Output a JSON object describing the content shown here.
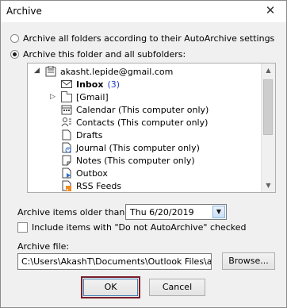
{
  "window": {
    "title": "Archive",
    "close_glyph": "✕"
  },
  "options": {
    "archive_all": {
      "label": "Archive all folders according to their AutoArchive settings",
      "selected": false
    },
    "archive_this": {
      "label": "Archive this folder and all subfolders:",
      "selected": true
    }
  },
  "tree": {
    "root": {
      "label": "akasht.lepide@gmail.com",
      "toggle": "◢",
      "icon": "mailbox-icon"
    },
    "items": [
      {
        "label": "Inbox",
        "count": "(3)",
        "icon": "envelope-icon",
        "bold": true
      },
      {
        "label": "[Gmail]",
        "icon": "folder-icon",
        "toggle": "▷"
      },
      {
        "label": "Calendar (This computer only)",
        "icon": "calendar-icon"
      },
      {
        "label": "Contacts (This computer only)",
        "icon": "contacts-icon"
      },
      {
        "label": "Drafts",
        "icon": "drafts-icon"
      },
      {
        "label": "Journal (This computer only)",
        "icon": "journal-icon"
      },
      {
        "label": "Notes (This computer only)",
        "icon": "notes-icon"
      },
      {
        "label": "Outbox",
        "icon": "outbox-icon"
      },
      {
        "label": "RSS Feeds",
        "icon": "rss-icon"
      }
    ]
  },
  "older_than": {
    "label": "Archive items older than:",
    "value": "Thu 6/20/2019"
  },
  "no_autoarchive": {
    "label": "Include items with \"Do not AutoArchive\" checked",
    "checked": false
  },
  "archive_file": {
    "label": "Archive file:",
    "value": "C:\\Users\\AkashT\\Documents\\Outlook Files\\arc"
  },
  "buttons": {
    "browse": "Browse...",
    "ok": "OK",
    "cancel": "Cancel"
  },
  "colors": {
    "inbox_count": "#1f3fbf",
    "ok_focus_outline": "#7a1f2b",
    "rss": "#f08a24"
  }
}
